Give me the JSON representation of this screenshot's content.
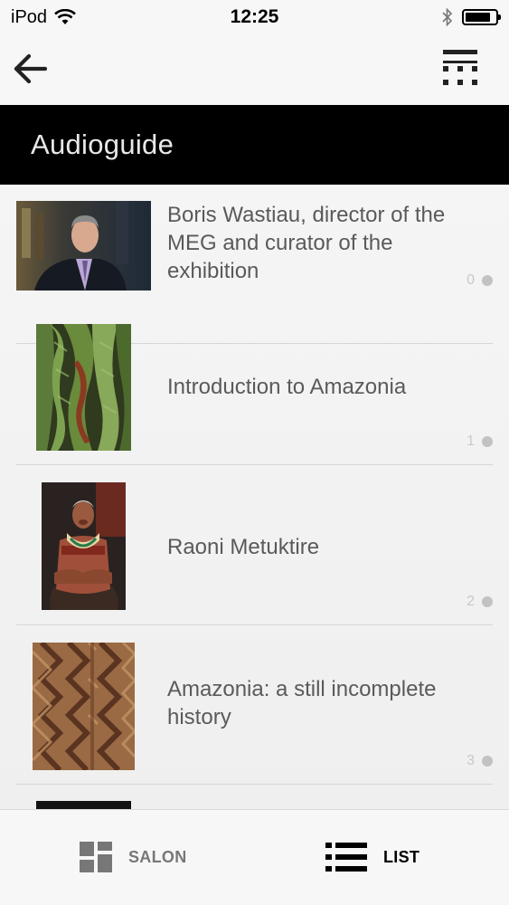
{
  "status_bar": {
    "carrier": "iPod",
    "time": "12:25",
    "battery_level": 0.85
  },
  "nav": {
    "back_icon": "back-arrow-icon",
    "grid_icon": "grid-view-icon"
  },
  "header": {
    "title": "Audioguide"
  },
  "items": [
    {
      "title": "Boris Wastiau, director of the MEG and curator of the exhibition",
      "number": "0",
      "thumb": "portrait-photo"
    },
    {
      "title": "Introduction to Amazonia",
      "number": "1",
      "thumb": "feather-object-photo"
    },
    {
      "title": "Raoni Metuktire",
      "number": "2",
      "thumb": "chief-portrait-photo"
    },
    {
      "title": "Amazonia: a still incomplete history",
      "number": "3",
      "thumb": "bark-pattern-photo"
    }
  ],
  "tab_bar": {
    "salon_label": "SALON",
    "list_label": "LIST",
    "active": "LIST"
  },
  "colors": {
    "header_bg": "#000000",
    "text": "#5a5a5a",
    "inactive_tab": "#777777"
  }
}
